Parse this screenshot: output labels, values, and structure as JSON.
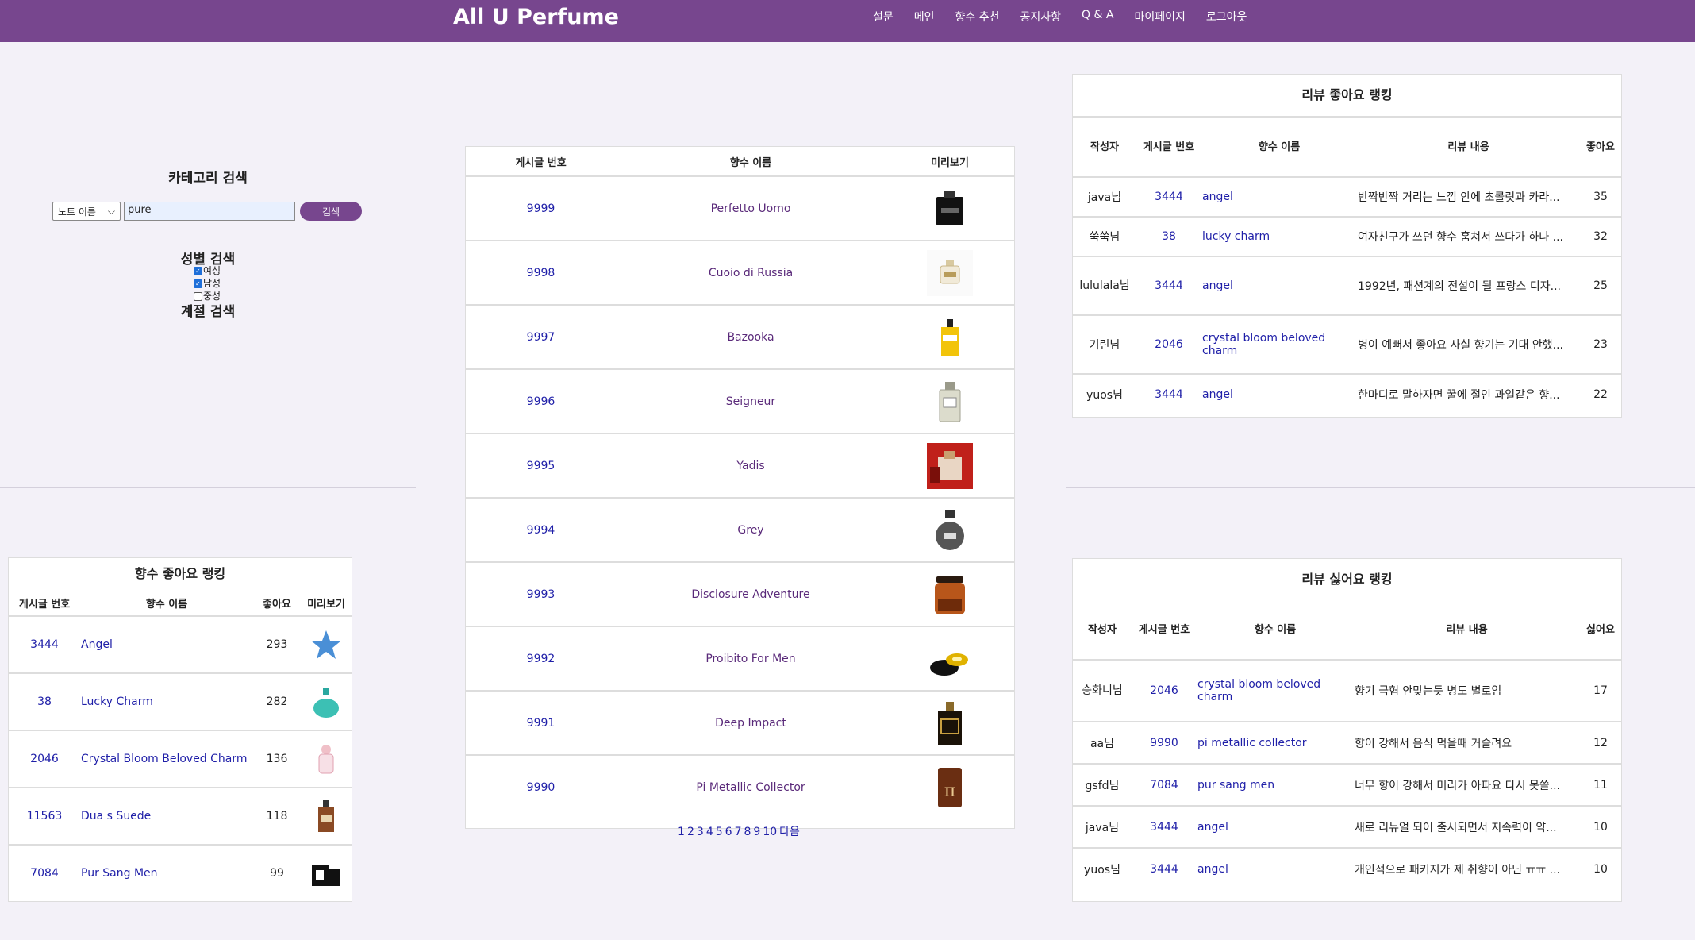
{
  "header": {
    "brand": "All U Perfume",
    "nav": [
      "설문",
      "메인",
      "향수 추천",
      "공지사항",
      "Q & A",
      "마이페이지",
      "로그아웃"
    ]
  },
  "search": {
    "category_title": "카테고리 검색",
    "select_value": "노트 이름",
    "input_value": "pure",
    "button_label": "검색",
    "gender_title": "성별 검색",
    "gender_options": [
      {
        "label": "여성",
        "checked": true
      },
      {
        "label": "남성",
        "checked": true
      },
      {
        "label": "중성",
        "checked": false
      }
    ],
    "season_title": "계절 검색"
  },
  "board": {
    "headers": [
      "게시글 번호",
      "향수 이름",
      "미리보기"
    ],
    "rows": [
      {
        "no": "9999",
        "name": "Perfetto Uomo",
        "thumb": "dark-bottle"
      },
      {
        "no": "9998",
        "name": "Cuoio di Russia",
        "thumb": "clear-bottle"
      },
      {
        "no": "9997",
        "name": "Bazooka",
        "thumb": "yellow-bottle"
      },
      {
        "no": "9996",
        "name": "Seigneur",
        "thumb": "glass-bottle"
      },
      {
        "no": "9995",
        "name": "Yadis",
        "thumb": "red-box"
      },
      {
        "no": "9994",
        "name": "Grey",
        "thumb": "silver-bottle"
      },
      {
        "no": "9993",
        "name": "Disclosure Adventure",
        "thumb": "amber-jar"
      },
      {
        "no": "9992",
        "name": "Proibito For Men",
        "thumb": "black-yellow"
      },
      {
        "no": "9991",
        "name": "Deep Impact",
        "thumb": "dark-gold-bottle"
      },
      {
        "no": "9990",
        "name": "Pi Metallic Collector",
        "thumb": "pi-box"
      }
    ],
    "pages": [
      "1",
      "2",
      "3",
      "4",
      "5",
      "6",
      "7",
      "8",
      "9",
      "10"
    ],
    "next_label": "다음"
  },
  "perfume_ranking": {
    "title": "향수 좋아요 랭킹",
    "headers": [
      "게시글 번호",
      "향수 이름",
      "좋아요",
      "미리보기"
    ],
    "rows": [
      {
        "no": "3444",
        "name": "Angel",
        "likes": "293",
        "thumb": "blue-star"
      },
      {
        "no": "38",
        "name": "Lucky Charm",
        "likes": "282",
        "thumb": "teal-bottle"
      },
      {
        "no": "2046",
        "name": "Crystal Bloom Beloved Charm",
        "likes": "136",
        "thumb": "pink-bottle"
      },
      {
        "no": "11563",
        "name": "Dua s Suede",
        "likes": "118",
        "thumb": "brown-bottle"
      },
      {
        "no": "7084",
        "name": "Pur Sang Men",
        "likes": "99",
        "thumb": "black-white-box"
      }
    ]
  },
  "review_like_ranking": {
    "title": "리뷰 좋아요 랭킹",
    "headers": [
      "작성자",
      "게시글 번호",
      "향수 이름",
      "리뷰 내용",
      "좋아요"
    ],
    "rows": [
      {
        "author": "java님",
        "no": "3444",
        "name": "angel",
        "content": "반짝반짝 거리는 느낌 안에 초콜릿과 카라...",
        "count": "35"
      },
      {
        "author": "쑥쑥님",
        "no": "38",
        "name": "lucky charm",
        "content": "여자친구가 쓰던 향수 훔쳐서 쓰다가 하나 ...",
        "count": "32"
      },
      {
        "author": "lululala님",
        "no": "3444",
        "name": "angel",
        "content": "1992년, 패션계의 전설이 될 프랑스 디자...",
        "count": "25"
      },
      {
        "author": "기린님",
        "no": "2046",
        "name": "crystal bloom beloved charm",
        "content": "병이 예뻐서 좋아요 사실 향기는 기대 안했...",
        "count": "23"
      },
      {
        "author": "yuos님",
        "no": "3444",
        "name": "angel",
        "content": "한마디로 말하자면 꿀에 절인 과일같은 향...",
        "count": "22"
      }
    ]
  },
  "review_dislike_ranking": {
    "title": "리뷰 싫어요 랭킹",
    "headers": [
      "작성자",
      "게시글 번호",
      "향수 이름",
      "리뷰 내용",
      "싫어요"
    ],
    "rows": [
      {
        "author": "승화니님",
        "no": "2046",
        "name": "crystal bloom beloved charm",
        "content": "향기 극혐 안맞는듯 병도 별로임",
        "count": "17"
      },
      {
        "author": "aa님",
        "no": "9990",
        "name": "pi metallic collector",
        "content": "향이 강해서 음식 먹을때 거슬려요",
        "count": "12"
      },
      {
        "author": "gsfd님",
        "no": "7084",
        "name": "pur sang men",
        "content": "너무 향이 강해서 머리가 아파요 다시 못쓸...",
        "count": "11"
      },
      {
        "author": "java님",
        "no": "3444",
        "name": "angel",
        "content": "새로 리뉴얼 되어 출시되면서 지속력이 약...",
        "count": "10"
      },
      {
        "author": "yuos님",
        "no": "3444",
        "name": "angel",
        "content": "개인적으로 패키지가 제 취향이 아닌 ㅠㅠ ...",
        "count": "10"
      }
    ]
  },
  "colors": {
    "brand": "#77468e",
    "link": "#1f1fa8",
    "background": "#f3f1f8"
  }
}
